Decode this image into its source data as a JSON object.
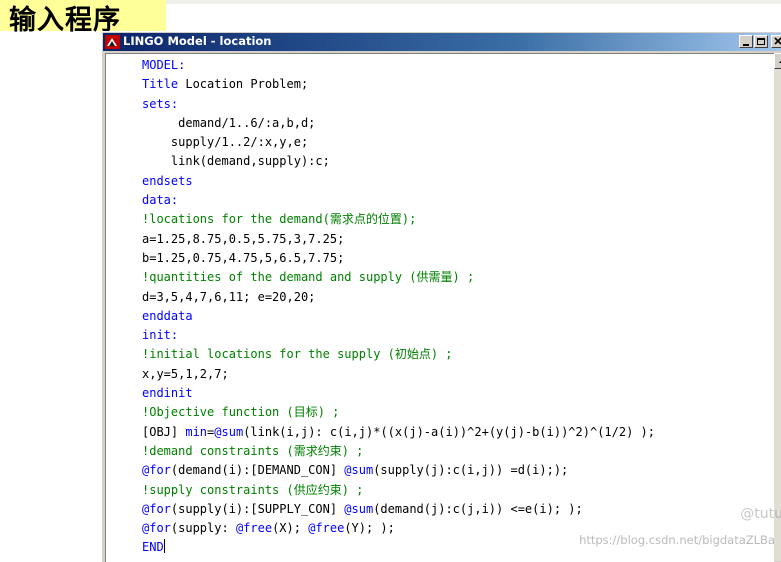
{
  "slide": {
    "title": "输入程序"
  },
  "window": {
    "title": "LINGO Model - location",
    "minimize_label": "_",
    "restore_label": "□",
    "close_label": "×",
    "icon": "lingo-app-icon"
  },
  "colors": {
    "keyword": "#0000ff",
    "comment": "#008000",
    "text": "#000000",
    "slide_title_bg": "#ffff99",
    "titlebar": "#0a246a"
  },
  "code": {
    "lines": [
      [
        {
          "t": "kw",
          "s": "MODEL:"
        }
      ],
      [
        {
          "t": "kw",
          "s": "Title"
        },
        {
          "t": "tx",
          "s": " Location Problem;"
        }
      ],
      [
        {
          "t": "kw",
          "s": "sets:"
        }
      ],
      [
        {
          "t": "tx",
          "s": "     demand/1..6/:a,b,d;"
        }
      ],
      [
        {
          "t": "tx",
          "s": "    supply/1..2/:x,y,e;"
        }
      ],
      [
        {
          "t": "tx",
          "s": "    link(demand,supply):c;"
        }
      ],
      [
        {
          "t": "kw",
          "s": "endsets"
        }
      ],
      [
        {
          "t": "kw",
          "s": "data:"
        }
      ],
      [
        {
          "t": "cm",
          "s": "!locations for the demand(需求点的位置);"
        }
      ],
      [
        {
          "t": "tx",
          "s": "a=1.25,8.75,0.5,5.75,3,7.25;"
        }
      ],
      [
        {
          "t": "tx",
          "s": "b=1.25,0.75,4.75,5,6.5,7.75;"
        }
      ],
      [
        {
          "t": "cm",
          "s": "!quantities of the demand and supply (供需量) ;"
        }
      ],
      [
        {
          "t": "tx",
          "s": "d=3,5,4,7,6,11; e=20,20;"
        }
      ],
      [
        {
          "t": "kw",
          "s": "enddata"
        }
      ],
      [
        {
          "t": "kw",
          "s": "init:"
        }
      ],
      [
        {
          "t": "cm",
          "s": "!initial locations for the supply (初始点) ;"
        }
      ],
      [
        {
          "t": "tx",
          "s": "x,y=5,1,2,7;"
        }
      ],
      [
        {
          "t": "kw",
          "s": "endinit"
        }
      ],
      [
        {
          "t": "cm",
          "s": "!Objective function (目标) ;"
        }
      ],
      [
        {
          "t": "tx",
          "s": "[OBJ] "
        },
        {
          "t": "kw",
          "s": "min"
        },
        {
          "t": "tx",
          "s": "="
        },
        {
          "t": "kw",
          "s": "@sum"
        },
        {
          "t": "tx",
          "s": "(link(i,j): c(i,j)*((x(j)-a(i))^2+(y(j)-b(i))^2)^(1/2) );"
        }
      ],
      [
        {
          "t": "cm",
          "s": "!demand constraints (需求约束) ;"
        }
      ],
      [
        {
          "t": "kw",
          "s": "@for"
        },
        {
          "t": "tx",
          "s": "(demand(i):[DEMAND_CON] "
        },
        {
          "t": "kw",
          "s": "@sum"
        },
        {
          "t": "tx",
          "s": "(supply(j):c(i,j)) =d(i););"
        }
      ],
      [
        {
          "t": "cm",
          "s": "!supply constraints (供应约束) ;"
        }
      ],
      [
        {
          "t": "kw",
          "s": "@for"
        },
        {
          "t": "tx",
          "s": "(supply(i):[SUPPLY_CON] "
        },
        {
          "t": "kw",
          "s": "@sum"
        },
        {
          "t": "tx",
          "s": "(demand(j):c(j,i)) <=e(i); );"
        }
      ],
      [
        {
          "t": "kw",
          "s": "@for"
        },
        {
          "t": "tx",
          "s": "(supply: "
        },
        {
          "t": "kw",
          "s": "@free"
        },
        {
          "t": "tx",
          "s": "(X); "
        },
        {
          "t": "kw",
          "s": "@free"
        },
        {
          "t": "tx",
          "s": "(Y); );"
        }
      ],
      [
        {
          "t": "kw",
          "s": "END"
        }
      ]
    ]
  },
  "watermark": {
    "url": "https://blog.csdn.net/bigdataZLBa",
    "handle": "@tutu"
  }
}
